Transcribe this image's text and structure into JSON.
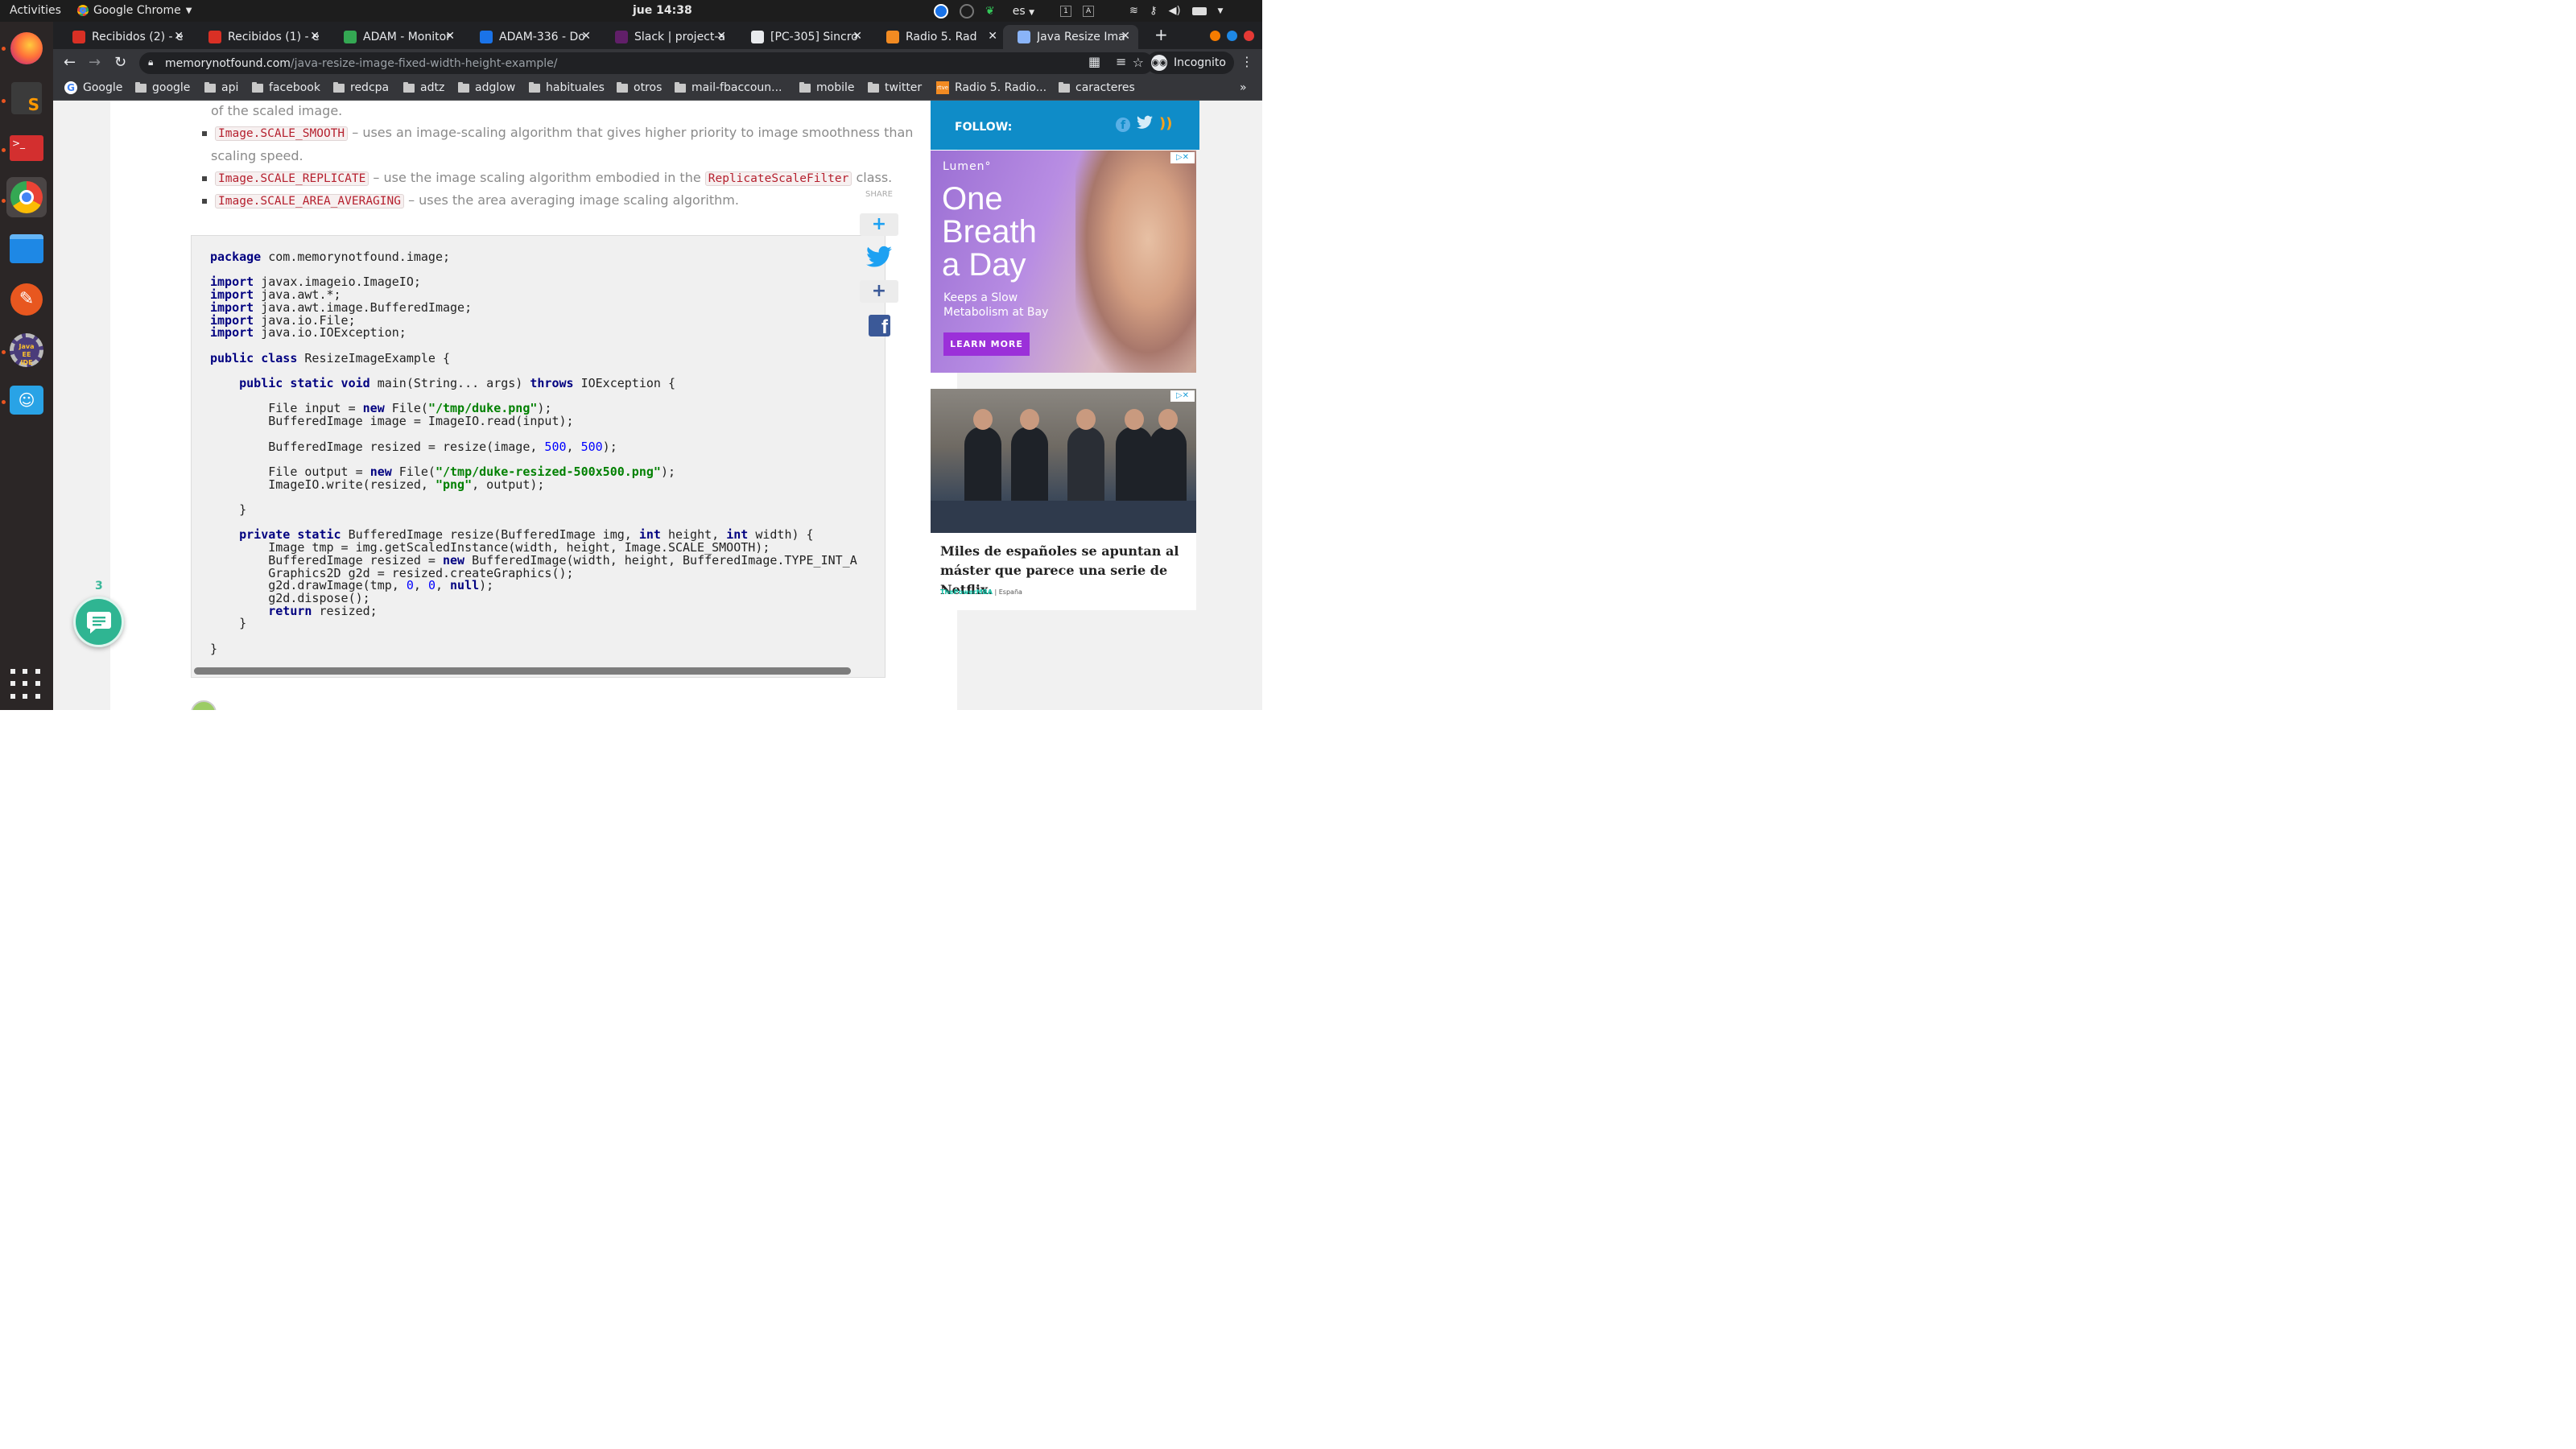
{
  "system": {
    "activities": "Activities",
    "app_menu": "Google Chrome",
    "clock": "jue 14:38",
    "keyboard_layout": "es"
  },
  "browser": {
    "tabs": [
      {
        "title": "Recibidos (2) - e",
        "favicon_color": "#d93025"
      },
      {
        "title": "Recibidos (1) - e",
        "favicon_color": "#d93025"
      },
      {
        "title": "ADAM - Monitor",
        "favicon_color": "#34a853"
      },
      {
        "title": "ADAM-336 - Do",
        "favicon_color": "#1a73e8"
      },
      {
        "title": "Slack | project-a",
        "favicon_color": "#611f69"
      },
      {
        "title": "[PC-305] Sincro",
        "favicon_color": "#e8eaed"
      },
      {
        "title": "Radio 5. Rad",
        "favicon_color": "#f28b22"
      },
      {
        "title": "Java Resize Ima",
        "favicon_color": "#8ab4f8"
      }
    ],
    "url_host": "memorynotfound.com",
    "url_path": "/java-resize-image-fixed-width-height-example/",
    "incognito_label": "Incognito",
    "bookmarks": [
      {
        "label": "Google",
        "type": "site"
      },
      {
        "label": "google",
        "type": "folder"
      },
      {
        "label": "api",
        "type": "folder"
      },
      {
        "label": "facebook",
        "type": "folder"
      },
      {
        "label": "redcpa",
        "type": "folder"
      },
      {
        "label": "adtz",
        "type": "folder"
      },
      {
        "label": "adglow",
        "type": "folder"
      },
      {
        "label": "habituales",
        "type": "folder"
      },
      {
        "label": "otros",
        "type": "folder"
      },
      {
        "label": "mail-fbaccoun...",
        "type": "folder"
      },
      {
        "label": "mobile",
        "type": "folder"
      },
      {
        "label": "twitter",
        "type": "folder"
      },
      {
        "label": "Radio 5. Radio...",
        "type": "site"
      },
      {
        "label": "caracteres",
        "type": "folder"
      }
    ],
    "more_bookmarks": "»"
  },
  "article": {
    "partial_line": "of the scaled image.",
    "bullets": [
      {
        "code": "Image.SCALE_SMOOTH",
        "text1": " – uses an image-scaling algorithm that gives higher priority to image smoothness than",
        "text2": "scaling speed."
      },
      {
        "code": "Image.SCALE_REPLICATE",
        "text1": " – use the image scaling algorithm embodied in the ",
        "code2": "ReplicateScaleFilter",
        "text3": " class."
      },
      {
        "code": "Image.SCALE_AREA_AVERAGING",
        "text1": " – uses the area averaging image scaling algorithm."
      }
    ]
  },
  "share": {
    "label": "SHARE"
  },
  "sidebar": {
    "follow_label": "FOLLOW:",
    "ad1": {
      "brand": "Lumen°",
      "headline": [
        "One",
        "Breath",
        "a Day"
      ],
      "subline": "Keeps a Slow Metabolism at Bay",
      "cta": "LEARN MORE"
    },
    "ad2": {
      "headline": "Miles de españoles se apuntan al máster que parece una serie de Netflix.",
      "source_brand": "ThePowerMBA",
      "source_rest": " | España"
    }
  },
  "chat": {
    "count": "3"
  }
}
